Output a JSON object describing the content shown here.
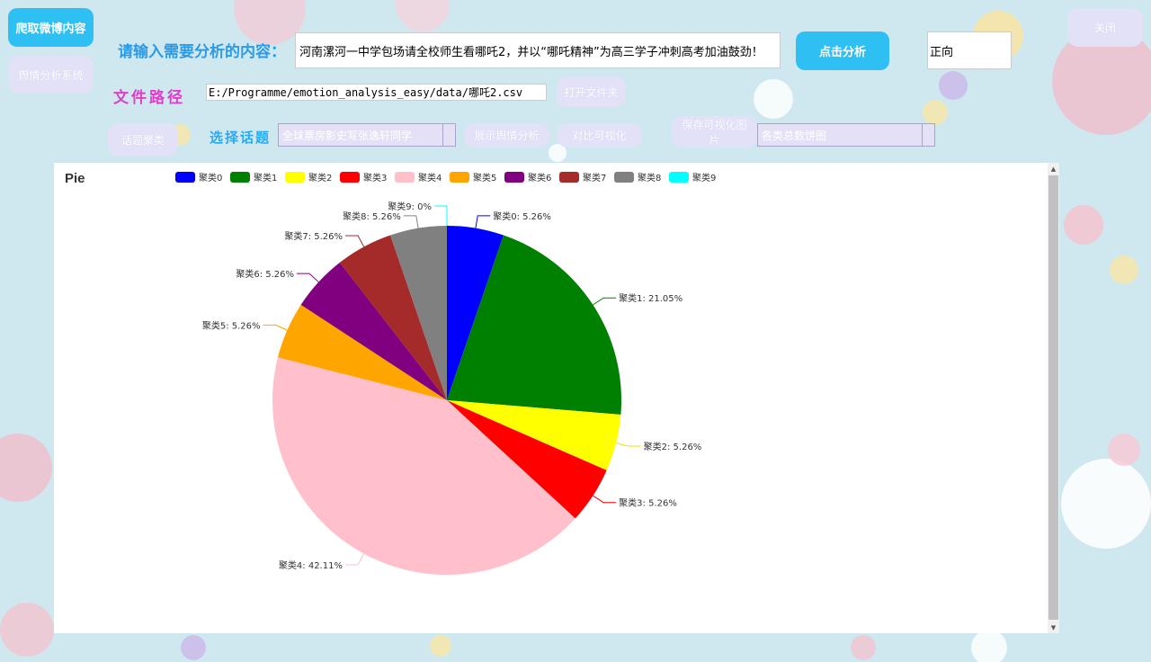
{
  "buttons": {
    "crawl": "爬取微博内容",
    "system": "舆情分析系统",
    "analyze": "点击分析",
    "close": "关闭",
    "open_folder": "打开文件夹",
    "topic_cluster": "话题聚类",
    "show_sentiment": "展示舆情分析",
    "compare_viz": "对比可视化",
    "save_viz": "保存可视化图片"
  },
  "labels": {
    "input_prompt": "请输入需要分析的内容：",
    "file_path": "文件路径",
    "select_topic": "选择话题"
  },
  "inputs": {
    "content": "河南漯河一中学包场请全校师生看哪吒2，并以“哪吒精神”为高三学子冲刺高考加油鼓劲！",
    "sentiment_result": "正向",
    "file_path": "E:/Programme/emotion_analysis_easy/data/哪吒2.csv",
    "topic_selected": "全球票房影史写张逸轩同学",
    "chart_selected": "各类总数饼图"
  },
  "chart_data": {
    "type": "pie",
    "title": "Pie",
    "legend_position": "top",
    "slices": [
      {
        "name": "聚类0",
        "value": 5.26,
        "label": "聚类0: 5.26%",
        "color": "#0000ff"
      },
      {
        "name": "聚类1",
        "value": 21.05,
        "label": "聚类1: 21.05%",
        "color": "#008000"
      },
      {
        "name": "聚类2",
        "value": 5.26,
        "label": "聚类2: 5.26%",
        "color": "#ffff00"
      },
      {
        "name": "聚类3",
        "value": 5.26,
        "label": "聚类3: 5.26%",
        "color": "#ff0000"
      },
      {
        "name": "聚类4",
        "value": 42.11,
        "label": "聚类4: 42.11%",
        "color": "#ffc0cb"
      },
      {
        "name": "聚类5",
        "value": 5.26,
        "label": "聚类5: 5.26%",
        "color": "#ffa500"
      },
      {
        "name": "聚类6",
        "value": 5.26,
        "label": "聚类6: 5.26%",
        "color": "#800080"
      },
      {
        "name": "聚类7",
        "value": 5.26,
        "label": "聚类7: 5.26%",
        "color": "#a52a2a"
      },
      {
        "name": "聚类8",
        "value": 5.26,
        "label": "聚类8: 5.26%",
        "color": "#808080"
      },
      {
        "name": "聚类9",
        "value": 0,
        "label": "聚类9: 0%",
        "color": "#00ffff"
      }
    ]
  }
}
